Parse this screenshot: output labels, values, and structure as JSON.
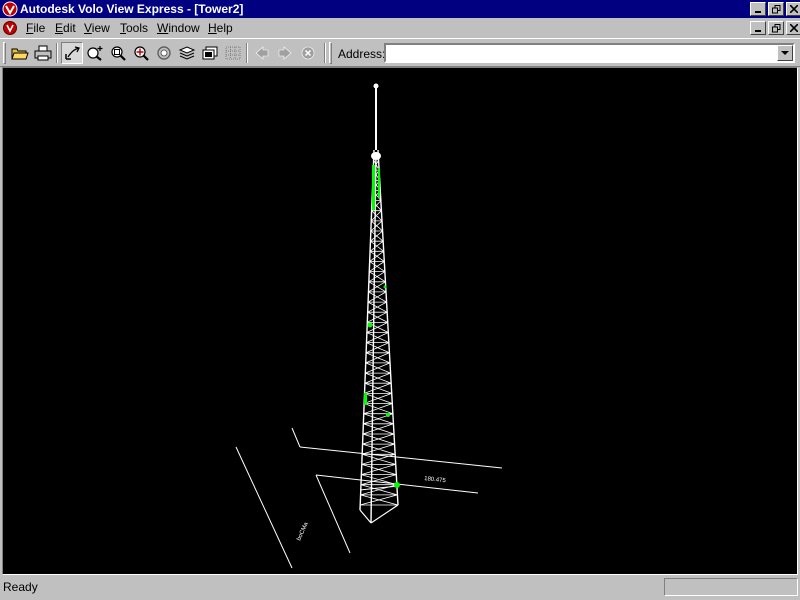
{
  "window": {
    "title": "Autodesk Volo View Express - [Tower2]"
  },
  "menu": {
    "items": [
      {
        "label": "File",
        "mnemonic": "F",
        "rest": "ile"
      },
      {
        "label": "Edit",
        "mnemonic": "E",
        "rest": "dit"
      },
      {
        "label": "View",
        "mnemonic": "V",
        "rest": "iew"
      },
      {
        "label": "Tools",
        "mnemonic": "T",
        "rest": "ools"
      },
      {
        "label": "Window",
        "mnemonic": "W",
        "rest": "indow"
      },
      {
        "label": "Help",
        "mnemonic": "H",
        "rest": "elp"
      }
    ]
  },
  "toolbar": {
    "buttons": [
      "open-icon",
      "print-icon",
      "orbit-icon",
      "zoom-realtime-icon",
      "zoom-window-icon",
      "zoom-extents-icon",
      "zoom-all-icon",
      "layers-icon",
      "named-views-icon",
      "grid-icon",
      "back-icon",
      "forward-icon",
      "stop-icon"
    ],
    "address_label": "Address:",
    "address_value": ""
  },
  "drawing": {
    "labels": [
      "180.475",
      "boCMa"
    ],
    "colors": {
      "background": "#000000",
      "lines": "#ffffff",
      "highlights": "#00ff00"
    }
  },
  "status": {
    "text": "Ready"
  },
  "colors": {
    "titlebar": "#000080",
    "chrome": "#c0c0c0"
  }
}
